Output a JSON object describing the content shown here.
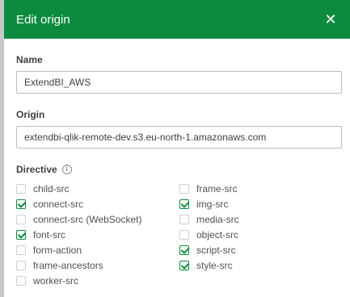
{
  "dialog": {
    "title": "Edit origin",
    "close_glyph": "✕",
    "accent": "#0c8b3e"
  },
  "name_field": {
    "label": "Name",
    "value": "ExtendBI_AWS"
  },
  "origin_field": {
    "label": "Origin",
    "value": "extendbi-qlik-remote-dev.s3.eu-north-1.amazonaws.com"
  },
  "directive": {
    "label": "Directive",
    "info_glyph": "i",
    "left": [
      {
        "label": "child-src",
        "checked": false
      },
      {
        "label": "connect-src",
        "checked": true
      },
      {
        "label": "connect-src (WebSocket)",
        "checked": false
      },
      {
        "label": "font-src",
        "checked": true
      },
      {
        "label": "form-action",
        "checked": false
      },
      {
        "label": "frame-ancestors",
        "checked": false
      },
      {
        "label": "worker-src",
        "checked": false
      }
    ],
    "right": [
      {
        "label": "frame-src",
        "checked": false
      },
      {
        "label": "img-src",
        "checked": true
      },
      {
        "label": "media-src",
        "checked": false
      },
      {
        "label": "object-src",
        "checked": false
      },
      {
        "label": "script-src",
        "checked": true
      },
      {
        "label": "style-src",
        "checked": true
      }
    ]
  }
}
